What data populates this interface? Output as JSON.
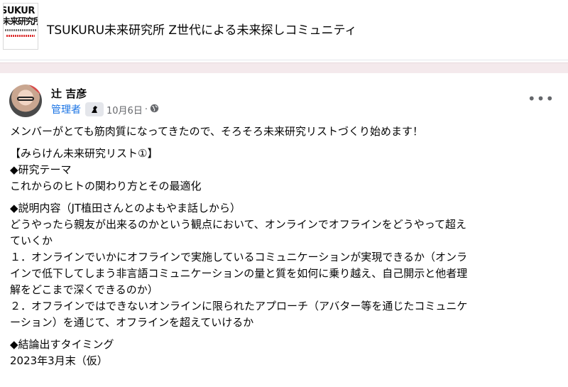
{
  "group": {
    "logo_line1": "SUKUR",
    "logo_line2": "未来研究所",
    "title": "TSUKURU未来研究所 Z世代による未来探しコミュニティ"
  },
  "post": {
    "author": "辻 吉彦",
    "role": "管理者",
    "date": "10月6日",
    "dot": "·",
    "privacy_icon": "globe-icon",
    "more_label": "•••",
    "lines": [
      "メンバーがとても筋肉質になってきたので、そろそろ未来研究リストづくり始めます！",
      "【みらけん未来研究リスト①】",
      "◆研究テーマ",
      "これからのヒトの関わり方とその最適化",
      "◆説明内容（JT植田さんとのよもやま話しから）",
      "どうやったら親友が出来るのかという観点において、オンラインでオフラインをどうやって超え",
      "ていくか",
      "１．オンラインでいかにオフラインで実施しているコミュニケーションが実現できるか（オンラ",
      "インで低下してしまう非言語コミュニケーションの量と質を如何に乗り越え、自己開示と他者理",
      "解をどこまで深くできるのか）",
      "２．オフラインではできないオンラインに限られたアプローチ（アバター等を通じたコミュニケ",
      "ーション）を通じて、オフラインを超えていけるか",
      "◆結論出すタイミング",
      "2023年3月末（仮）"
    ]
  },
  "colors": {
    "accent": "#1b74e4",
    "separator": "#f4e9ec",
    "meta": "#65676b"
  }
}
